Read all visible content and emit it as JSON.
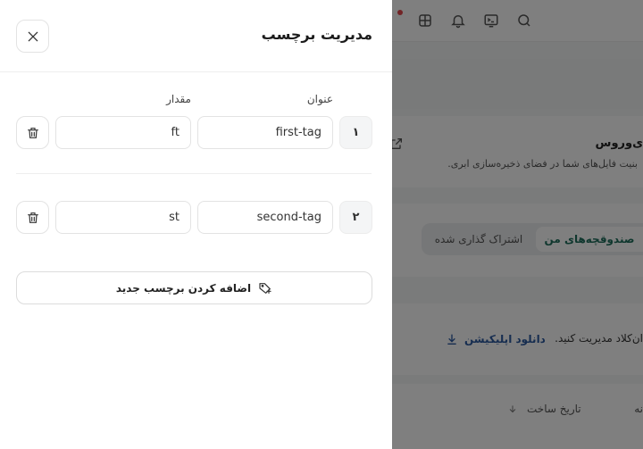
{
  "drawer": {
    "title": "مدیریت برچسب",
    "columns": {
      "title_label": "عنوان",
      "value_label": "مقدار"
    },
    "rows": [
      {
        "index": "۱",
        "title": "first-tag",
        "value": "ft"
      },
      {
        "index": "۲",
        "title": "second-tag",
        "value": "st"
      }
    ],
    "add_label": "اضافه کردن برچسب جدید"
  },
  "background": {
    "card_title": "ی‌وروس",
    "card_subtitle": "بنیت فایل‌های شما در فضای ذخیره‌سازی ابری.",
    "tabs": {
      "active": "صندوقچه‌های من",
      "inactive": "اشتراک گذاری شده"
    },
    "manage_text": "ان‌کلاد مدیریت کنید.",
    "download_label": "دانلود اپلیکیشن",
    "column_created": "تاریخ ساخت",
    "column_partial": "نه"
  },
  "icons": {
    "close": "close-icon",
    "trash": "trash-icon",
    "add_tag": "tag-add-icon",
    "search": "search-icon",
    "terminal": "terminal-icon",
    "bell": "bell-icon",
    "apps": "apps-icon",
    "external": "external-link-icon",
    "download": "download-icon",
    "sort": "arrow-down-icon"
  },
  "colors": {
    "accent": "#1f6f5c",
    "link": "#2c5aa0",
    "notification": "#e5484d"
  }
}
